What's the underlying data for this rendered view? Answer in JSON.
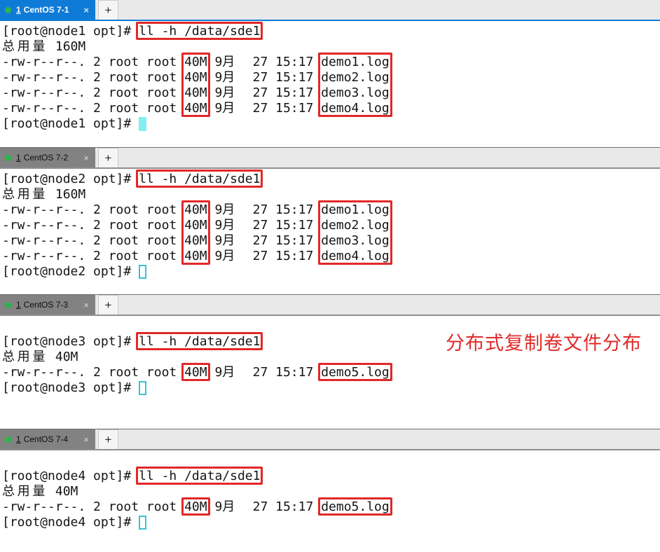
{
  "icons": {
    "close": "×",
    "plus": "+",
    "dot": "session-connected-green"
  },
  "colors": {
    "accent_blue": "#0f7bd7",
    "annotation_red": "#e12829",
    "cursor_cyan": "#35c4d4",
    "tab_green_dot": "#2cb34a"
  },
  "annotation": {
    "text": "分布式复制卷文件分布"
  },
  "panels": [
    {
      "tab": {
        "mnemonic": "1",
        "title": "CentOS 7-1",
        "state": "active-focused"
      },
      "lines": [
        [
          {
            "t": "[root@node1 opt]# "
          },
          {
            "t": "ll -h /data/sde1",
            "box": "full"
          }
        ],
        [
          {
            "t": "总用量 160M"
          }
        ],
        [
          {
            "t": "-rw-r--r--. 2 root root "
          },
          {
            "t": "40M",
            "box": "top"
          },
          {
            "t": " 9月  27 15:17 "
          },
          {
            "t": "demo1.log",
            "box": "top"
          }
        ],
        [
          {
            "t": "-rw-r--r--. 2 root root "
          },
          {
            "t": "40M",
            "box": "mid"
          },
          {
            "t": " 9月  27 15:17 "
          },
          {
            "t": "demo2.log",
            "box": "mid"
          }
        ],
        [
          {
            "t": "-rw-r--r--. 2 root root "
          },
          {
            "t": "40M",
            "box": "mid"
          },
          {
            "t": " 9月  27 15:17 "
          },
          {
            "t": "demo3.log",
            "box": "mid"
          }
        ],
        [
          {
            "t": "-rw-r--r--. 2 root root "
          },
          {
            "t": "40M",
            "box": "bot"
          },
          {
            "t": " 9月  27 15:17 "
          },
          {
            "t": "demo4.log",
            "box": "bot"
          }
        ],
        [
          {
            "t": "[root@node1 opt]# "
          },
          {
            "c": "filled"
          }
        ]
      ]
    },
    {
      "tab": {
        "mnemonic": "1",
        "title": "CentOS 7-2",
        "state": "active-unfocused"
      },
      "lines": [
        [
          {
            "t": "[root@node2 opt]# "
          },
          {
            "t": "ll -h /data/sde1",
            "box": "full"
          }
        ],
        [
          {
            "t": "总用量 160M"
          }
        ],
        [
          {
            "t": "-rw-r--r--. 2 root root "
          },
          {
            "t": "40M",
            "box": "top"
          },
          {
            "t": " 9月  27 15:17 "
          },
          {
            "t": "demo1.log",
            "box": "top"
          }
        ],
        [
          {
            "t": "-rw-r--r--. 2 root root "
          },
          {
            "t": "40M",
            "box": "mid"
          },
          {
            "t": " 9月  27 15:17 "
          },
          {
            "t": "demo2.log",
            "box": "mid"
          }
        ],
        [
          {
            "t": "-rw-r--r--. 2 root root "
          },
          {
            "t": "40M",
            "box": "mid"
          },
          {
            "t": " 9月  27 15:17 "
          },
          {
            "t": "demo3.log",
            "box": "mid"
          }
        ],
        [
          {
            "t": "-rw-r--r--. 2 root root "
          },
          {
            "t": "40M",
            "box": "bot"
          },
          {
            "t": " 9月  27 15:17 "
          },
          {
            "t": "demo4.log",
            "box": "bot"
          }
        ],
        [
          {
            "t": "[root@node2 opt]# "
          },
          {
            "c": "hollow"
          }
        ]
      ]
    },
    {
      "tab": {
        "mnemonic": "1",
        "title": "CentOS 7-3",
        "state": "active-unfocused"
      },
      "lines": [
        [],
        [
          {
            "t": "[root@node3 opt]# "
          },
          {
            "t": "ll -h /data/sde1",
            "box": "full"
          }
        ],
        [
          {
            "t": "总用量 40M"
          }
        ],
        [
          {
            "t": "-rw-r--r--. 2 root root "
          },
          {
            "t": "40M",
            "box": "full"
          },
          {
            "t": " 9月  27 15:17 "
          },
          {
            "t": "demo5.log",
            "box": "full"
          }
        ],
        [
          {
            "t": "[root@node3 opt]# "
          },
          {
            "c": "hollow"
          }
        ]
      ]
    },
    {
      "tab": {
        "mnemonic": "1",
        "title": "CentOS 7-4",
        "state": "active-unfocused"
      },
      "lines": [
        [],
        [
          {
            "t": "[root@node4 opt]# "
          },
          {
            "t": "ll -h /data/sde1",
            "box": "full"
          }
        ],
        [
          {
            "t": "总用量 40M"
          }
        ],
        [
          {
            "t": "-rw-r--r--. 2 root root "
          },
          {
            "t": "40M",
            "box": "full"
          },
          {
            "t": " 9月  27 15:17 "
          },
          {
            "t": "demo5.log",
            "box": "full"
          }
        ],
        [
          {
            "t": "[root@node4 opt]# "
          },
          {
            "c": "hollow"
          }
        ]
      ]
    }
  ]
}
